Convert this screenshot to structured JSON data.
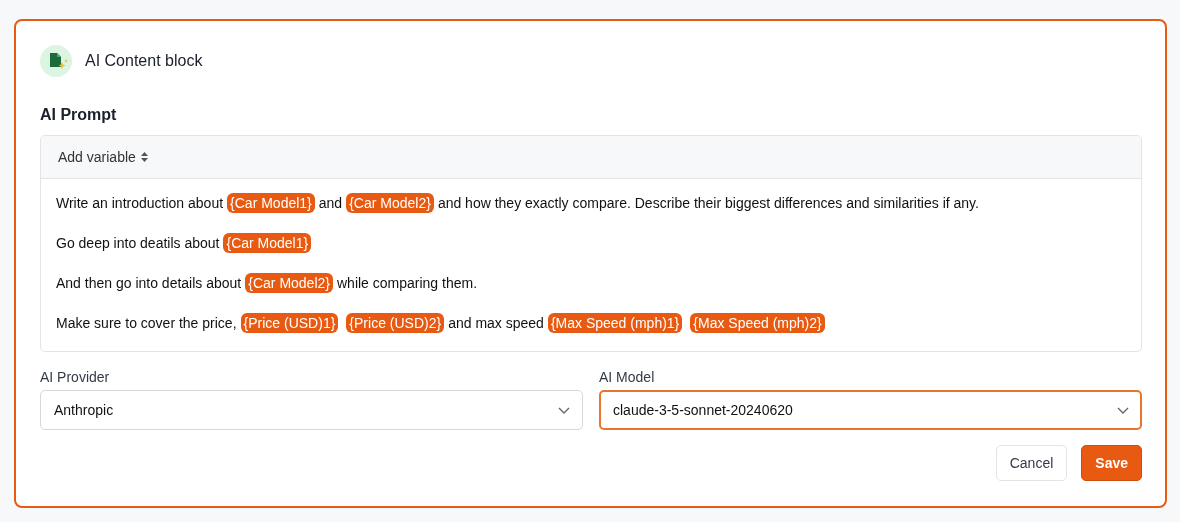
{
  "header": {
    "title": "AI Content block"
  },
  "prompt": {
    "label": "AI Prompt",
    "toolbar": {
      "add_variable": "Add variable"
    },
    "paragraphs": [
      [
        {
          "kind": "text",
          "text": "Write an introduction about"
        },
        {
          "kind": "variable",
          "text": "{Car Model1}"
        },
        {
          "kind": "text",
          "text": "and"
        },
        {
          "kind": "variable",
          "text": "{Car Model2}"
        },
        {
          "kind": "text",
          "text": "and how they exactly compare. Describe their biggest differences and similarities if any."
        }
      ],
      [
        {
          "kind": "text",
          "text": "Go deep into deatils about"
        },
        {
          "kind": "variable",
          "text": "{Car Model1}"
        }
      ],
      [
        {
          "kind": "text",
          "text": "And then go into details about"
        },
        {
          "kind": "variable",
          "text": "{Car Model2}"
        },
        {
          "kind": "text",
          "text": "while comparing them."
        }
      ],
      [
        {
          "kind": "text",
          "text": "Make sure to cover the price,"
        },
        {
          "kind": "variable",
          "text": "{Price (USD)1}"
        },
        {
          "kind": "variable",
          "text": "{Price (USD)2}"
        },
        {
          "kind": "text",
          "text": "and max speed"
        },
        {
          "kind": "variable",
          "text": "{Max Speed (mph)1}"
        },
        {
          "kind": "variable",
          "text": "{Max Speed (mph)2}"
        }
      ]
    ]
  },
  "selects": [
    {
      "label": "AI Provider",
      "value": "Anthropic",
      "focused": false
    },
    {
      "label": "AI Model",
      "value": "claude-3-5-sonnet-20240620",
      "focused": true
    }
  ],
  "buttons": [
    {
      "kind": "secondary",
      "label": "Cancel"
    },
    {
      "kind": "primary",
      "label": "Save"
    }
  ]
}
